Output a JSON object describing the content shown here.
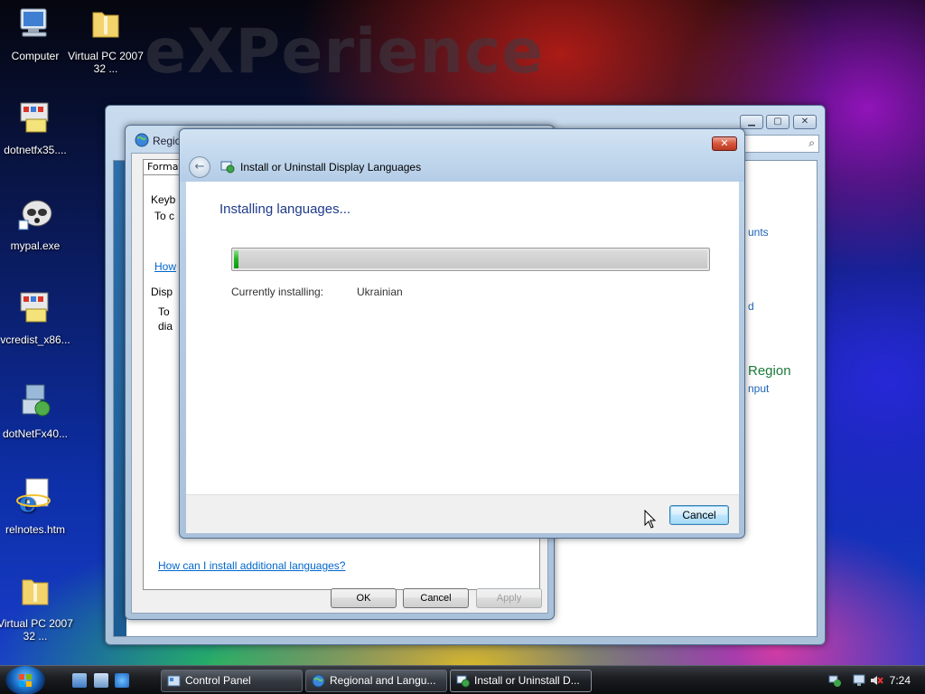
{
  "desktop": {
    "watermark": "eXPerience",
    "icons": [
      {
        "label": "Computer",
        "icon": "computer-icon"
      },
      {
        "label": "Virtual PC 2007 32 ...",
        "icon": "zip-folder-icon"
      },
      {
        "label": "dotnetfx35....",
        "icon": "installer-icon"
      },
      {
        "label": "mypal.exe",
        "icon": "raccoon-icon"
      },
      {
        "label": "vcredist_x86...",
        "icon": "installer-icon"
      },
      {
        "label": "dotNetFx40...",
        "icon": "setup-icon"
      },
      {
        "label": "relnotes.htm",
        "icon": "internet-explorer-icon"
      },
      {
        "label": "Virtual PC 2007 32 ...",
        "icon": "zip-folder-icon"
      }
    ]
  },
  "control_panel": {
    "fragments": [
      "unts",
      "d",
      "Region",
      "nput"
    ]
  },
  "regional_dialog": {
    "title": "Regio",
    "tab": "Formats",
    "keyboards_heading": "Keyb",
    "keyboards_text": "To c",
    "keyboards_link": "How",
    "display_heading": "Disp",
    "display_text_1": "To",
    "display_text_2": "dia",
    "install_link": "How can I install additional languages?",
    "ok": "OK",
    "cancel": "Cancel",
    "apply": "Apply"
  },
  "install_dialog": {
    "title": "Install or Uninstall Display Languages",
    "heading": "Installing languages...",
    "progress": 0.01,
    "currently_installing_label": "Currently installing:",
    "currently_installing_value": "Ukrainian",
    "cancel": "Cancel",
    "close_symbol": "✕"
  },
  "taskbar": {
    "tasks": [
      {
        "label": "Control Panel",
        "icon": "control-panel-icon",
        "active": false
      },
      {
        "label": "Regional and Langu...",
        "icon": "regional-icon",
        "active": false
      },
      {
        "label": "Install or Uninstall D...",
        "icon": "language-icon",
        "active": true
      }
    ],
    "clock": "7:24"
  }
}
